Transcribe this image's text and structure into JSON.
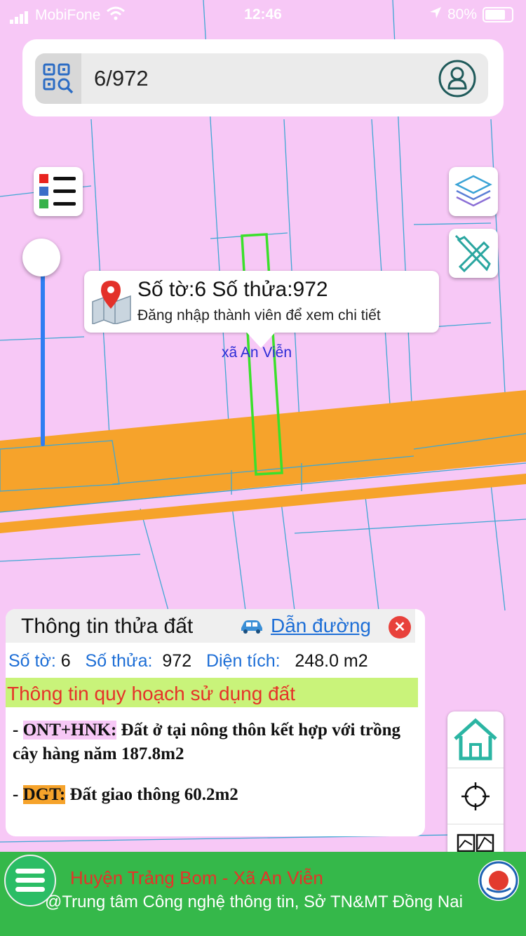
{
  "status_bar": {
    "carrier": "MobiFone",
    "time": "12:46",
    "battery": "80%"
  },
  "search": {
    "value": "6/972"
  },
  "popup": {
    "line1": "Số tờ:6 Số thửa:972",
    "line2": "Đăng nhập thành viên để xem chi tiết"
  },
  "map": {
    "commune_label": "xã An Viễn",
    "colors": {
      "residential": "#f7c8f6",
      "road": "#f6a32b",
      "highlight": "#3be02b"
    }
  },
  "panel": {
    "title": "Thông tin thửa đất",
    "route_label": "Dẫn đường",
    "sheet_label": "Số tờ:",
    "sheet_value": "6",
    "parcel_label": "Số thửa:",
    "parcel_value": "972",
    "area_label": "Diện tích:",
    "area_value": "248.0 m2",
    "planning_title": "Thông tin quy hoạch sử dụng đất",
    "items": [
      {
        "code": "ONT+HNK:",
        "description": "Đất ở tại nông thôn kết hợp với trồng cây hàng năm 187.8m2"
      },
      {
        "code": "DGT:",
        "description": "Đất giao thông 60.2m2"
      }
    ]
  },
  "footer": {
    "line1": "Huyện Trảng Bom - Xã An Viễn",
    "line2": "@Trung tâm Công nghệ thông tin, Sở TN&MT Đồng Nai"
  },
  "icons": [
    "qr-search-icon",
    "user-icon",
    "legend-icon",
    "layers-icon",
    "measure-icon",
    "map-pin-icon",
    "car-icon",
    "close-icon",
    "home-icon",
    "crosshair-icon",
    "map-tiles-icon",
    "menu-icon",
    "logo-icon"
  ]
}
